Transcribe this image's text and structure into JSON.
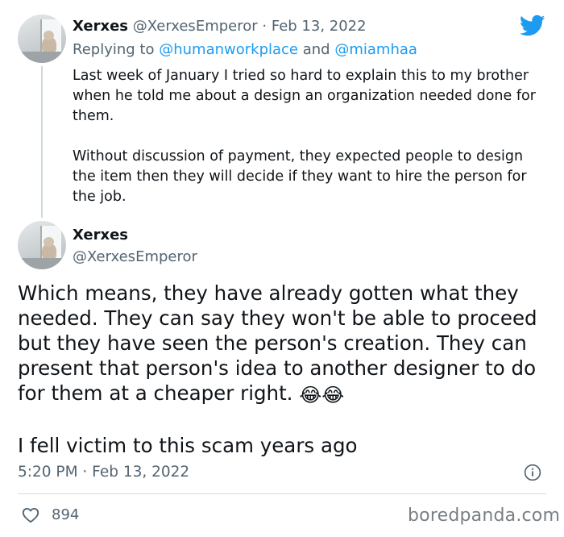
{
  "reply_tweet": {
    "display_name": "Xerxes",
    "handle": "@XerxesEmperor",
    "date": "Feb 13, 2022",
    "separator": "·",
    "replying_prefix": "Replying to",
    "replying_user_1": "@humanworkplace",
    "replying_and": "and",
    "replying_user_2": "@miamhaa",
    "paragraph_1": "Last week of January I tried so hard to explain this to my brother when he told me about a design an organization needed done for them.",
    "paragraph_2": "Without discussion of payment, they expected people to design the item then they will decide if they want to hire the person for the job."
  },
  "main_tweet": {
    "display_name": "Xerxes",
    "handle": "@XerxesEmperor",
    "paragraph_1": "Which means, they have already gotten what they needed. They can say they won't be able to proceed but they have seen the person's creation. They can present that person's idea to another designer to do for them at a cheaper right.",
    "emoji": "😂😂",
    "paragraph_2": "I fell victim to this scam years ago",
    "timestamp": "5:20 PM · Feb 13, 2022",
    "like_count": "894"
  },
  "watermark": "boredpanda.com",
  "icons": {
    "brand": "twitter-bird-icon",
    "info": "info-icon",
    "like": "heart-icon"
  },
  "colors": {
    "accent": "#1d9bf0",
    "text": "#0f1419",
    "muted": "#536471",
    "divider": "#cfd9de"
  }
}
